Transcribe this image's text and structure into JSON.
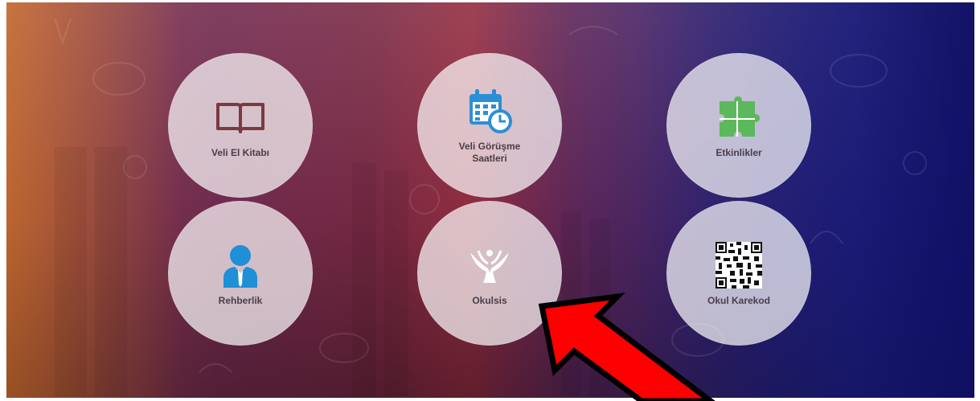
{
  "tiles": [
    {
      "label": "Veli El Kitabı",
      "icon": "book-icon"
    },
    {
      "label": "Veli Görüşme Saatleri",
      "icon": "calendar-clock-icon"
    },
    {
      "label": "Etkinlikler",
      "icon": "puzzle-icon"
    },
    {
      "label": "Rehberlik",
      "icon": "counselor-person-icon"
    },
    {
      "label": "Okulsis",
      "icon": "okulsis-logo-icon"
    },
    {
      "label": "Okul Karekod",
      "icon": "qr-code-icon"
    }
  ],
  "colors": {
    "tile_bg": "#ffffffb3",
    "label_text": "#4a3d4a",
    "book": "#7a3a40",
    "calendar": "#2b8fd6",
    "puzzle": "#5cb85c",
    "person": "#1f8fd6",
    "arrow_fill": "#ff0000",
    "arrow_outline": "#000000"
  }
}
